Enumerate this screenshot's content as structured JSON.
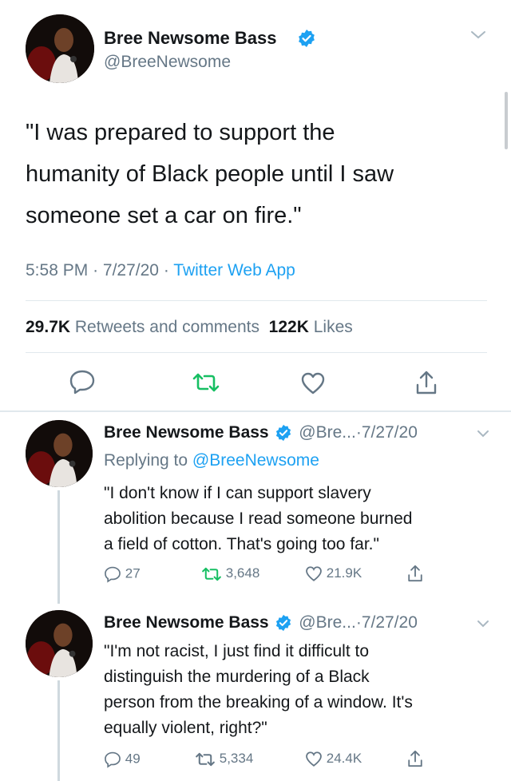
{
  "main_tweet": {
    "author_name": "Bree Newsome Bass",
    "handle": "@BreeNewsome",
    "text_line1": "\"I was prepared to support the",
    "text_line2": "humanity of Black people until I saw",
    "text_line3": "someone set a car on fire.\"",
    "time": "5:58 PM",
    "date": "7/27/20",
    "source": "Twitter Web App",
    "retweets_count": "29.7K",
    "retweets_label": "Retweets and comments",
    "likes_count": "122K",
    "likes_label": "Likes"
  },
  "replies": [
    {
      "author_name": "Bree Newsome Bass",
      "handle": "@Bre...",
      "date": "7/27/20",
      "replying_prefix": "Replying to",
      "replying_handle": "@BreeNewsome",
      "line1": "\"I don't know if I can support slavery",
      "line2": "abolition because I read someone burned",
      "line3": "a field of cotton. That's going too far.\"",
      "line4": "",
      "replies": "27",
      "retweets": "3,648",
      "likes": "21.9K"
    },
    {
      "author_name": "Bree Newsome Bass",
      "handle": "@Bre...",
      "date": "7/27/20",
      "line1": "\"I'm not racist, I just find it difficult to",
      "line2": "distinguish the murdering of a Black",
      "line3": "person from the breaking of a window. It's",
      "line4": "equally violent, right?\"",
      "replies": "49",
      "retweets": "5,334",
      "likes": "24.4K"
    }
  ],
  "separators": {
    "dot": "·"
  },
  "colors": {
    "accent": "#1da1f2",
    "retweet": "#17bf63",
    "muted": "#657786"
  }
}
